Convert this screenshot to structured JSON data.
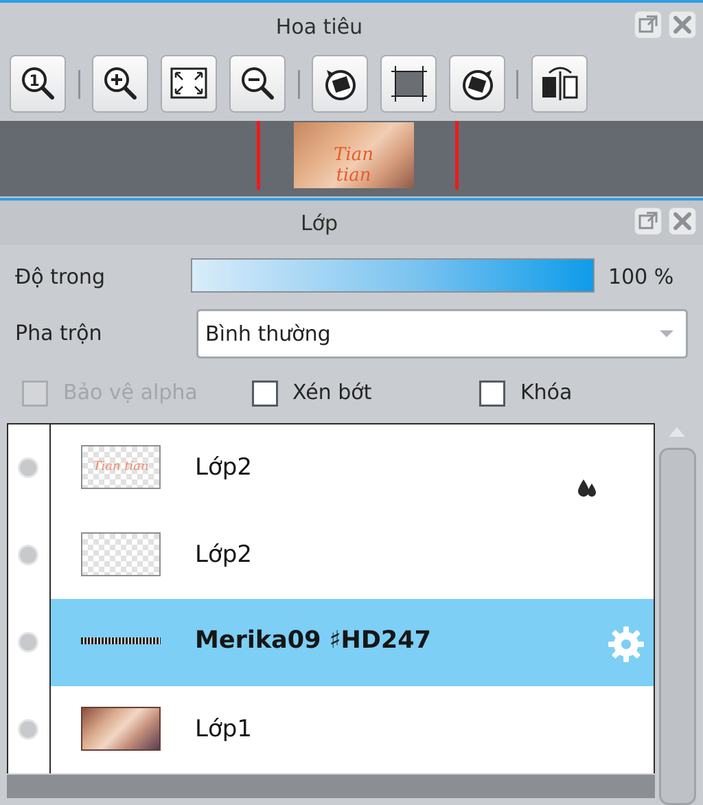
{
  "navigator": {
    "title": "Hoa tiêu",
    "toolbar": [
      {
        "icon": "zoom-actual-size-icon"
      },
      {
        "icon": "zoom-in-icon"
      },
      {
        "icon": "fit-to-window-icon"
      },
      {
        "icon": "zoom-out-icon"
      },
      {
        "icon": "rotate-left-icon"
      },
      {
        "icon": "reset-view-icon"
      },
      {
        "icon": "rotate-right-icon"
      },
      {
        "icon": "flip-horizontal-icon"
      }
    ],
    "thumbnail_text": "Tian tian"
  },
  "layers_panel": {
    "title": "Lớp",
    "opacity_label": "Độ trong",
    "opacity_value": "100 %",
    "opacity_percent": 100,
    "blend_label": "Pha trộn",
    "blend_value": "Bình thường",
    "protect_alpha_label": "Bảo vệ alpha",
    "clip_label": "Xén bớt",
    "lock_label": "Khóa",
    "layers": [
      {
        "name": "Lớp2",
        "indicator_icon": "drops-icon"
      },
      {
        "name": "Lớp2"
      },
      {
        "name": "Merika09 ♯HD247",
        "selected": true,
        "indicator_icon": "gear-icon"
      },
      {
        "name": "Lớp1"
      }
    ]
  },
  "colors": {
    "accent": "#2f9fe6",
    "selected_row": "#7dcff6",
    "navigator_marker": "#ee1b1b"
  }
}
